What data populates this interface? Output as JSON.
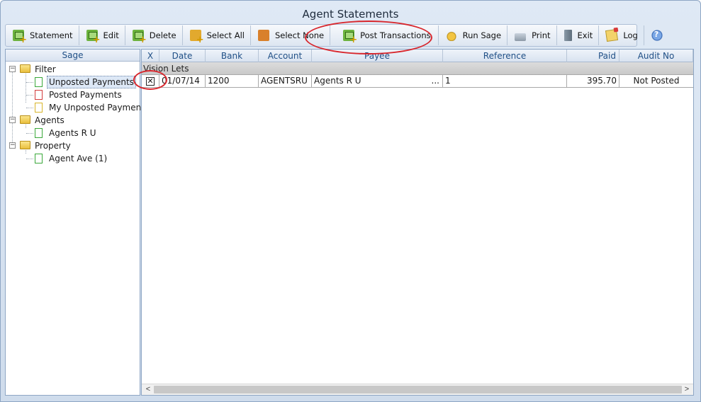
{
  "window": {
    "title": "Agent Statements"
  },
  "toolbar": {
    "statement": "Statement",
    "edit": "Edit",
    "delete": "Delete",
    "select_all": "Select All",
    "select_none": "Select None",
    "post_transactions": "Post Transactions",
    "run_sage": "Run Sage",
    "print": "Print",
    "exit": "Exit",
    "log": "Log"
  },
  "sidebar": {
    "header": "Sage",
    "filter": {
      "label": "Filter",
      "items": [
        "Unposted Payments",
        "Posted Payments",
        "My Unposted Payments"
      ]
    },
    "agents": {
      "label": "Agents",
      "items": [
        "Agents R U"
      ]
    },
    "property": {
      "label": "Property",
      "items": [
        "Agent Ave (1)"
      ]
    }
  },
  "grid": {
    "columns": [
      "X",
      "Date",
      "Bank",
      "Account",
      "Payee",
      "Reference",
      "Paid",
      "Audit No"
    ],
    "group": "Vision Lets",
    "rows": [
      {
        "checked": "✕",
        "date": "01/07/14",
        "bank": "1200",
        "account": "AGENTSRU",
        "payee": "Agents R U",
        "payee_more": "...",
        "reference": "1",
        "paid": "395.70",
        "audit_no": "Not Posted"
      }
    ]
  },
  "scrollbar": {
    "left": "<",
    "right": ">"
  },
  "colors": {
    "annotation": "#d8262c",
    "header_text": "#1f4f86"
  }
}
